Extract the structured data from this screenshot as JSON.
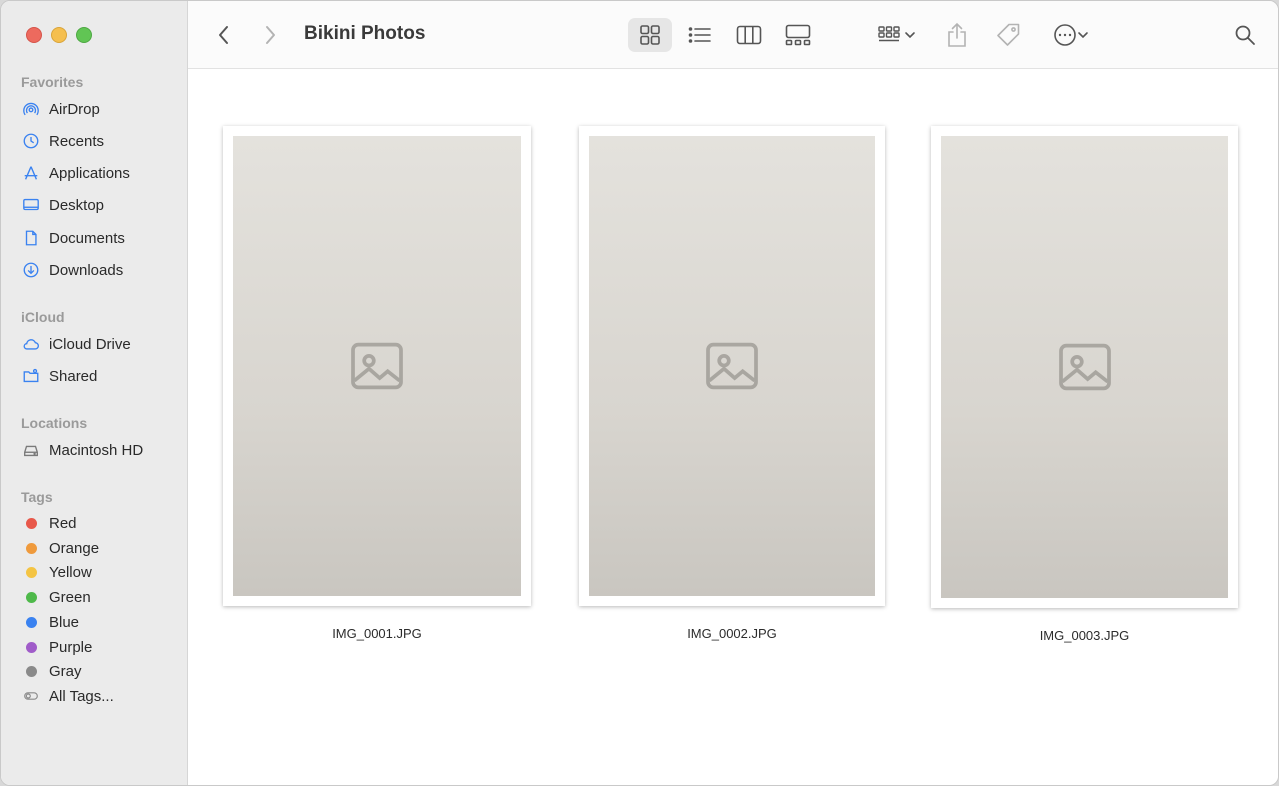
{
  "window": {
    "folder_title": "Bikini Photos"
  },
  "sidebar": {
    "favorites_label": "Favorites",
    "favorites": [
      {
        "label": "AirDrop",
        "icon": "airdrop-icon"
      },
      {
        "label": "Recents",
        "icon": "clock-icon"
      },
      {
        "label": "Applications",
        "icon": "applications-icon"
      },
      {
        "label": "Desktop",
        "icon": "desktop-icon"
      },
      {
        "label": "Documents",
        "icon": "document-icon"
      },
      {
        "label": "Downloads",
        "icon": "download-icon"
      }
    ],
    "icloud_label": "iCloud",
    "icloud": [
      {
        "label": "iCloud Drive",
        "icon": "cloud-icon"
      },
      {
        "label": "Shared",
        "icon": "shared-folder-icon"
      }
    ],
    "locations_label": "Locations",
    "locations": [
      {
        "label": "Macintosh HD",
        "icon": "disk-icon"
      }
    ],
    "tags_label": "Tags",
    "tags": [
      {
        "label": "Red",
        "color": "#e8584a"
      },
      {
        "label": "Orange",
        "color": "#ef9a3c"
      },
      {
        "label": "Yellow",
        "color": "#f4c443"
      },
      {
        "label": "Green",
        "color": "#4eb94a"
      },
      {
        "label": "Blue",
        "color": "#3a82f0"
      },
      {
        "label": "Purple",
        "color": "#a05cc9"
      },
      {
        "label": "Gray",
        "color": "#8a8a8a"
      }
    ],
    "all_tags_label": "All Tags..."
  },
  "toolbar": {
    "icons": [
      "back-icon",
      "forward-icon",
      "icon-view-icon",
      "list-view-icon",
      "column-view-icon",
      "gallery-view-icon",
      "group-icon",
      "share-icon",
      "tag-icon",
      "more-icon",
      "search-icon"
    ]
  },
  "files": [
    {
      "name": "IMG_0001.JPG"
    },
    {
      "name": "IMG_0002.JPG"
    },
    {
      "name": "IMG_0003.JPG"
    }
  ]
}
